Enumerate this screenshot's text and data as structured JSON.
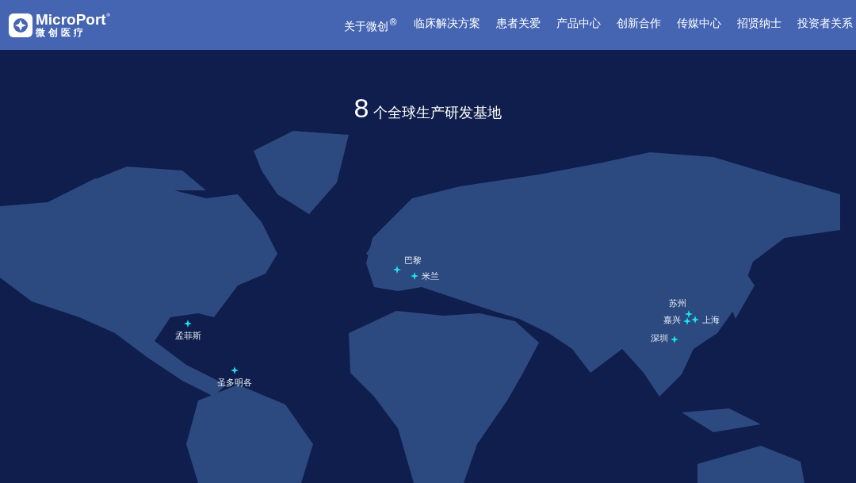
{
  "header": {
    "logo": {
      "brand": "MicroPort",
      "trademark": "®",
      "brand_cn": "微创医疗"
    },
    "nav": [
      {
        "label": "关于微创$^{®}$"
      },
      {
        "label": "临床解决方案"
      },
      {
        "label": "患者关爱"
      },
      {
        "label": "产品中心"
      },
      {
        "label": "创新合作"
      },
      {
        "label": "传媒中心"
      },
      {
        "label": "招贤纳士"
      },
      {
        "label": "投资者关系"
      }
    ]
  },
  "map": {
    "title": {
      "count": "8",
      "text": "个全球生产研发基地"
    },
    "sites": [
      {
        "label": "孟菲斯"
      },
      {
        "label": "圣多明各"
      },
      {
        "label": "巴黎"
      },
      {
        "label": "米兰"
      },
      {
        "label": "苏州"
      },
      {
        "label": "嘉兴"
      },
      {
        "label": "上海"
      },
      {
        "label": "深圳"
      }
    ]
  }
}
